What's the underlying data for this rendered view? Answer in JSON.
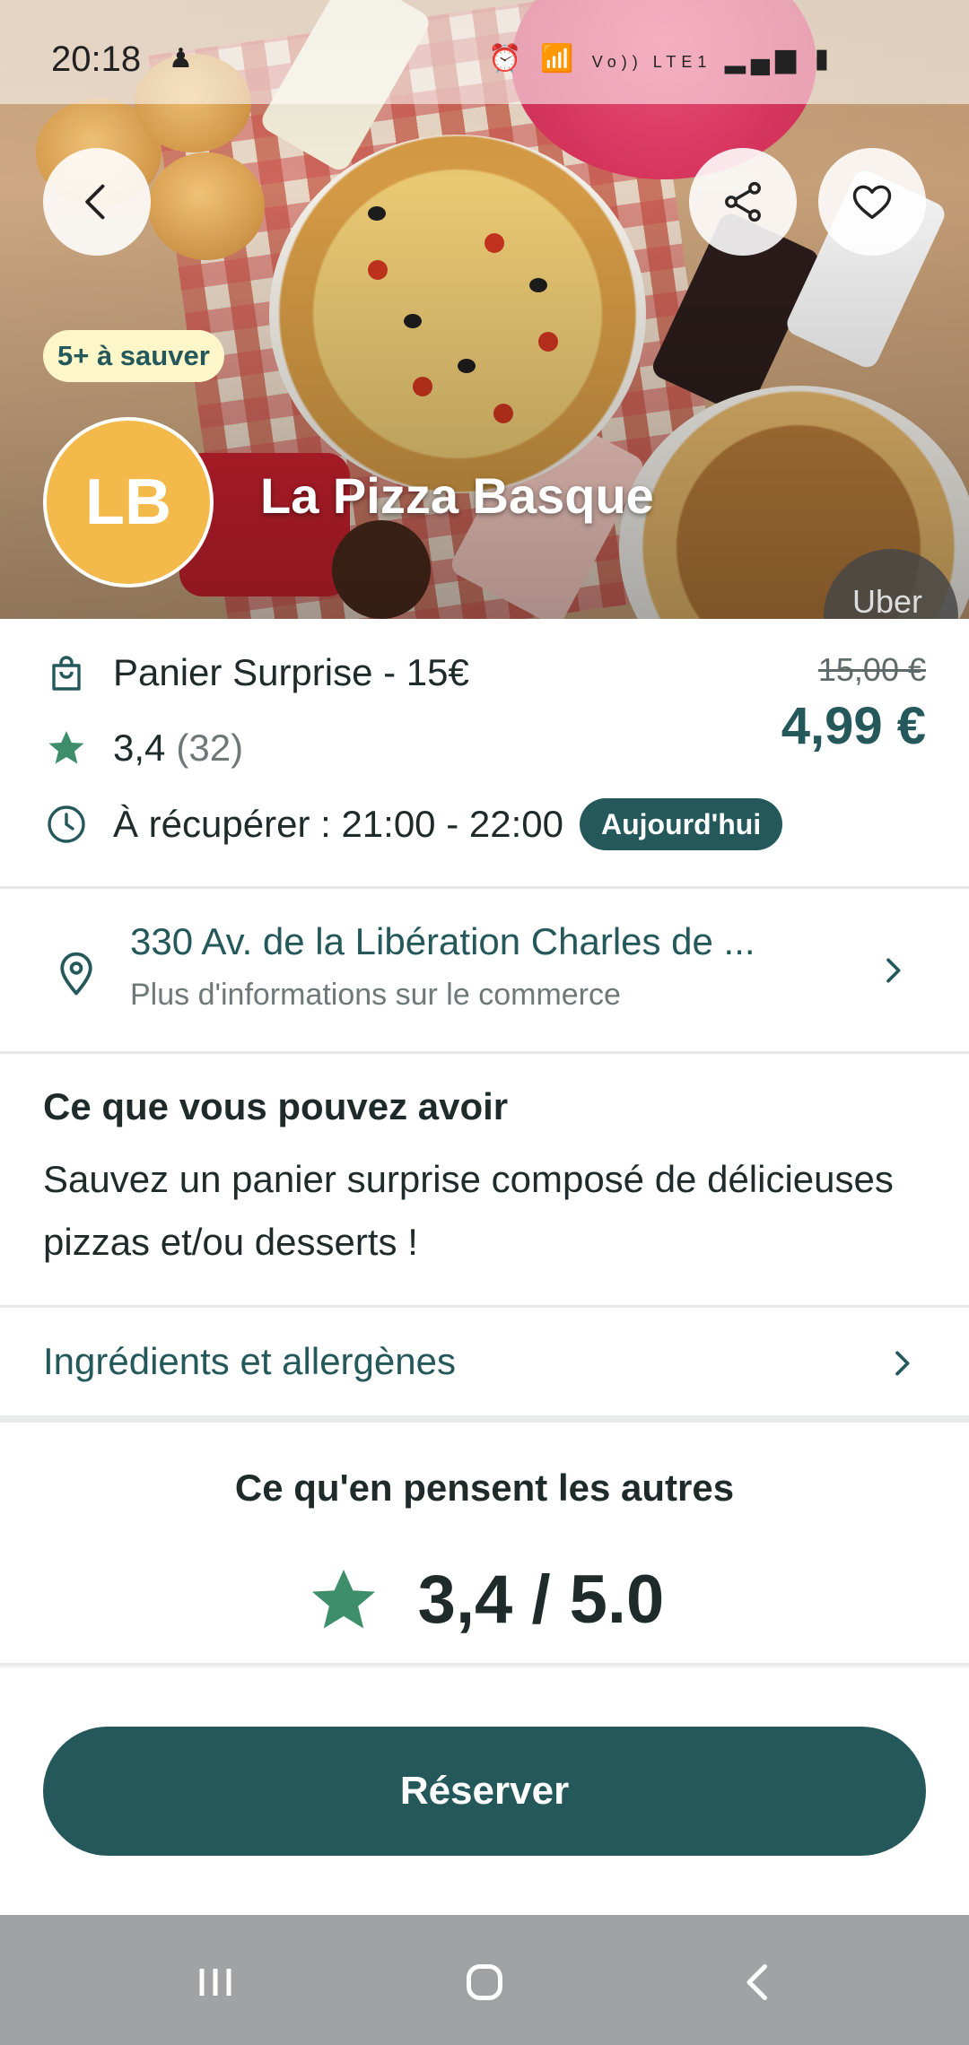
{
  "status_bar": {
    "time": "20:18",
    "icons": [
      "notification-icon",
      "alarm-icon",
      "wifi-icon",
      "volte-icon",
      "signal-icon",
      "battery-icon"
    ],
    "network_label": "Vo)) LTE1"
  },
  "hero": {
    "save_badge": "5+ à sauver",
    "logo_initials": "LB",
    "store_name": "La Pizza Basque",
    "watermark": "Uber",
    "buttons": [
      "back-button",
      "share-button",
      "favorite-button"
    ]
  },
  "offer": {
    "title": "Panier Surprise - 15€",
    "rating": "3,4",
    "rating_count": "(32)",
    "pickup": "À récupérer : 21:00 - 22:00",
    "pickup_badge": "Aujourd'hui",
    "old_price": "15,00 €",
    "new_price": "4,99 €"
  },
  "address": {
    "line1": "330 Av. de la Libération Charles de ...",
    "line2": "Plus d'informations sur le commerce"
  },
  "description": {
    "title": "Ce que vous pouvez avoir",
    "body": "Sauvez un panier surprise composé de délicieuses pizzas et/ou desserts !"
  },
  "ingredients": {
    "label": "Ingrédients et allergènes"
  },
  "reviews": {
    "title": "Ce qu'en pensent les autres",
    "score": "3,4 / 5.0"
  },
  "cta": {
    "reserve_label": "Réserver"
  },
  "colors": {
    "brand": "#24585a",
    "star": "#3f8e6b",
    "logo": "#f3b94a",
    "badge": "#fdf6c8"
  }
}
